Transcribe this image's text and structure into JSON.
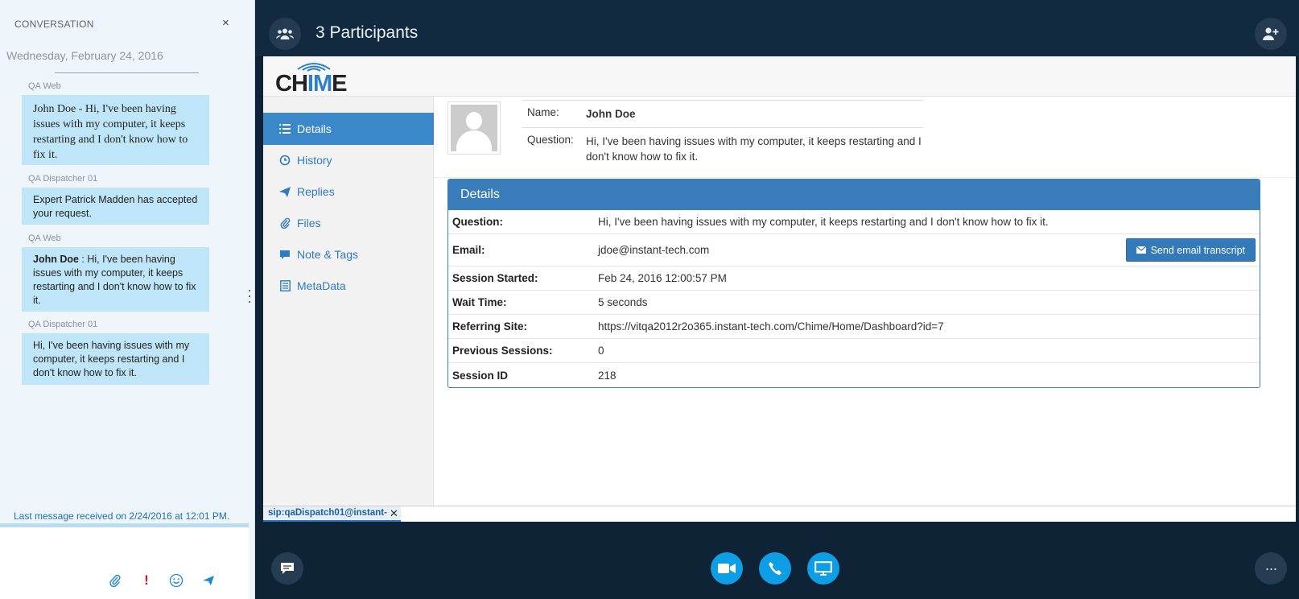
{
  "conversation": {
    "header": "CONVERSATION",
    "close": "×",
    "date": "Wednesday, February 24, 2016",
    "messages": [
      {
        "sender": "QA Web",
        "text": "John Doe - Hi, I've been having issues with my computer, it keeps restarting and I don't know how to fix it."
      },
      {
        "sender": "QA Dispatcher 01",
        "text": "Expert Patrick Madden has accepted your request."
      },
      {
        "sender": "QA Web",
        "bold": "John Doe",
        "text": " : Hi, I've been having issues with my computer, it keeps restarting and I don't know how to fix it."
      },
      {
        "sender": "QA Dispatcher 01",
        "text": "Hi, I've been having issues with my computer, it keeps restarting and I don't know how to fix it."
      }
    ],
    "last_message": "Last message received on 2/24/2016 at 12:01 PM.",
    "compose_icons": [
      "paperclip-icon",
      "important-icon",
      "emoji-icon",
      "send-icon"
    ]
  },
  "topbar": {
    "participants": "3 Participants",
    "left_icon": "participants-icon",
    "right_icon": "add-participant-icon"
  },
  "chime": {
    "logo_left": "CH",
    "logo_accent": "IM",
    "logo_right": "E",
    "nav": [
      {
        "label": "Details",
        "icon": "list-icon",
        "active": true
      },
      {
        "label": "History",
        "icon": "history-icon"
      },
      {
        "label": "Replies",
        "icon": "send-icon"
      },
      {
        "label": "Files",
        "icon": "paperclip-icon"
      },
      {
        "label": "Note & Tags",
        "icon": "comment-icon"
      },
      {
        "label": "MetaData",
        "icon": "document-icon"
      }
    ],
    "summary": {
      "name_label": "Name:",
      "name_value": "John Doe",
      "question_label": "Question:",
      "question_value": "Hi, I've been having issues with my computer, it keeps restarting and I don't know how to fix it."
    },
    "details": {
      "title": "Details",
      "send_button": "Send email transcript",
      "rows": [
        {
          "label": "Question:",
          "value": "Hi, I've been having issues with my computer, it keeps restarting and I don't know how to fix it."
        },
        {
          "label": "Email:",
          "value": "jdoe@instant-tech.com"
        },
        {
          "label": "Session Started:",
          "value": "Feb 24, 2016 12:00:57 PM"
        },
        {
          "label": "Wait Time:",
          "value": "5 seconds"
        },
        {
          "label": "Referring Site:",
          "value": "https://vitqa2012r2o365.instant-tech.com/Chime/Home/Dashboard?id=7"
        },
        {
          "label": "Previous Sessions:",
          "value": "0"
        },
        {
          "label": "Session ID",
          "value": "218"
        }
      ]
    },
    "tab": {
      "label": "sip:qaDispatch01@instant-",
      "close": "✕"
    }
  },
  "bottombar": {
    "chat_icon": "chat-icon",
    "video_icon": "video-icon",
    "phone_icon": "phone-icon",
    "share_icon": "screen-share-icon",
    "more": "···"
  }
}
